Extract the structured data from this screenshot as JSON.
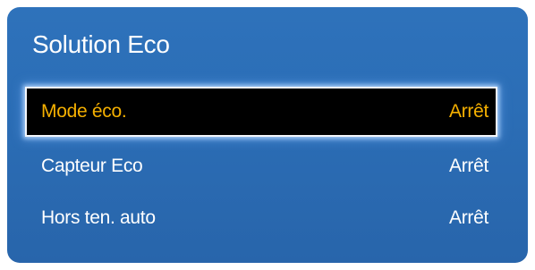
{
  "panel": {
    "title": "Solution Eco"
  },
  "menu": {
    "items": [
      {
        "label": "Mode éco.",
        "value": "Arrêt",
        "selected": true
      },
      {
        "label": "Capteur Eco",
        "value": "Arrêt",
        "selected": false
      },
      {
        "label": "Hors ten. auto",
        "value": "Arrêt",
        "selected": false
      }
    ]
  },
  "colors": {
    "panel_background": "#2b6db5",
    "selected_background": "#000000",
    "selected_text": "#f5b000",
    "text": "#ffffff"
  }
}
